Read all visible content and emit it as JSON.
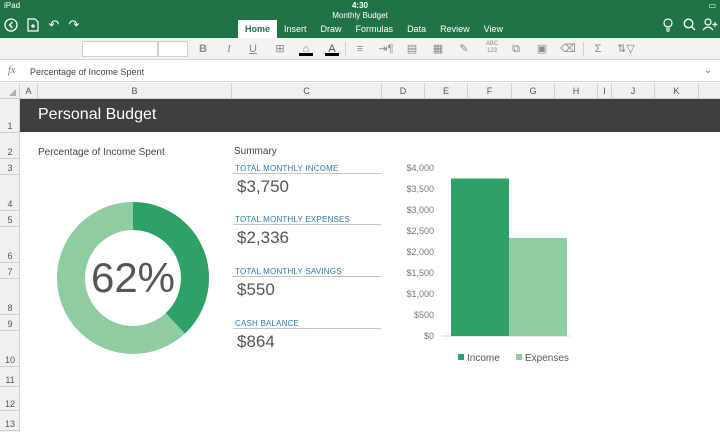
{
  "status": {
    "device": "iPad",
    "time": "4:30"
  },
  "document": {
    "title": "Monthly Budget"
  },
  "ribbon": {
    "tabs": [
      {
        "label": "Home",
        "active": true
      },
      {
        "label": "Insert",
        "active": false
      },
      {
        "label": "Draw",
        "active": false
      },
      {
        "label": "Formulas",
        "active": false
      },
      {
        "label": "Data",
        "active": false
      },
      {
        "label": "Review",
        "active": false
      },
      {
        "label": "View",
        "active": false
      }
    ]
  },
  "toolbar": {
    "bold": "B",
    "italic": "I",
    "underline": "U",
    "font_color_label": "A",
    "fill_color": "#000000",
    "spelling_label": "ABC 123"
  },
  "formula_bar": {
    "fx": "fx",
    "content": "Percentage of Income Spent"
  },
  "columns": [
    "A",
    "B",
    "C",
    "D",
    "E",
    "F",
    "G",
    "H",
    "I",
    "J",
    "K"
  ],
  "rows": [
    "1",
    "2",
    "3",
    "4",
    "5",
    "6",
    "7",
    "8",
    "9",
    "10",
    "11",
    "12",
    "13"
  ],
  "sheet": {
    "title": "Personal Budget",
    "percent_heading": "Percentage of Income Spent",
    "percent_value": "62%",
    "summary_heading": "Summary",
    "kpis": [
      {
        "label": "TOTAL MONTHLY INCOME",
        "value": "$3,750"
      },
      {
        "label": "TOTAL MONTHLY EXPENSES",
        "value": "$2,336"
      },
      {
        "label": "TOTAL MONTHLY SAVINGS",
        "value": "$550"
      },
      {
        "label": "CASH BALANCE",
        "value": "$864"
      }
    ]
  },
  "donut": {
    "spent_fraction": 0.62,
    "spent_color": "#2ea169",
    "remaining_color": "#8fcca1"
  },
  "chart_data": {
    "type": "bar",
    "categories": [
      ""
    ],
    "series": [
      {
        "name": "Income",
        "values": [
          3750
        ],
        "color": "#2ea169"
      },
      {
        "name": "Expenses",
        "values": [
          2336
        ],
        "color": "#8fcca1"
      }
    ],
    "yticks": [
      "$0",
      "$500",
      "$1,000",
      "$1,500",
      "$2,000",
      "$2,500",
      "$3,000",
      "$3,500",
      "$4,000"
    ],
    "ylim": [
      0,
      4000
    ],
    "grid": false,
    "legend": "bottom"
  },
  "colors": {
    "ribbon": "#217346",
    "title_band": "#3f3f3f",
    "kpi_label": "#2b7bb2"
  }
}
